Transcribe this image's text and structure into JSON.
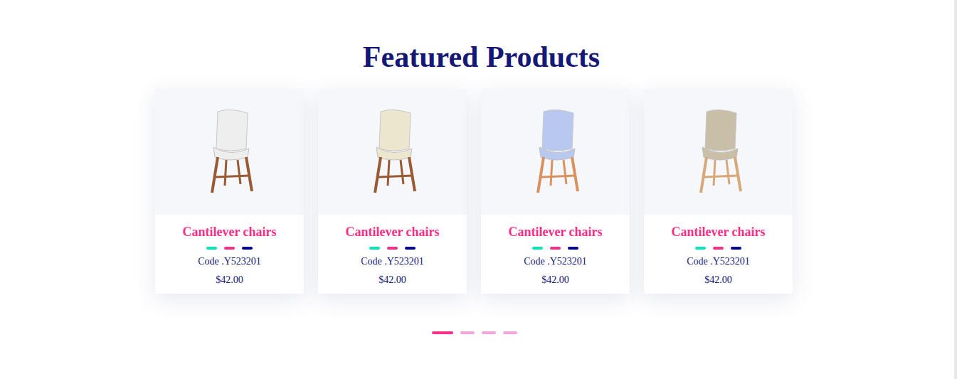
{
  "title": "Featured Products",
  "products": [
    {
      "name": "Cantilever chairs",
      "colors": [
        {
          "color": "#05e6b7"
        },
        {
          "color": "#fb2e86"
        },
        {
          "color": "#00009d"
        }
      ],
      "code": "Code .Y523201",
      "price": "$42.00"
    },
    {
      "name": "Cantilever chairs",
      "colors": [
        {
          "color": "#05e6b7"
        },
        {
          "color": "#fb2e86"
        },
        {
          "color": "#00009d"
        }
      ],
      "code": "Code .Y523201",
      "price": "$42.00"
    },
    {
      "name": "Cantilever chairs",
      "colors": [
        {
          "color": "#05e6b7"
        },
        {
          "color": "#fb2e86"
        },
        {
          "color": "#00009d"
        }
      ],
      "code": "Code .Y523201",
      "price": "$42.00"
    },
    {
      "name": "Cantilever chairs",
      "colors": [
        {
          "color": "#05e6b7"
        },
        {
          "color": "#fb2e86"
        },
        {
          "color": "#00009d"
        }
      ],
      "code": "Code .Y523201",
      "price": "$42.00"
    }
  ],
  "pagination": [
    {
      "selected": true
    },
    {
      "selected": false
    },
    {
      "selected": false
    },
    {
      "selected": false
    }
  ]
}
